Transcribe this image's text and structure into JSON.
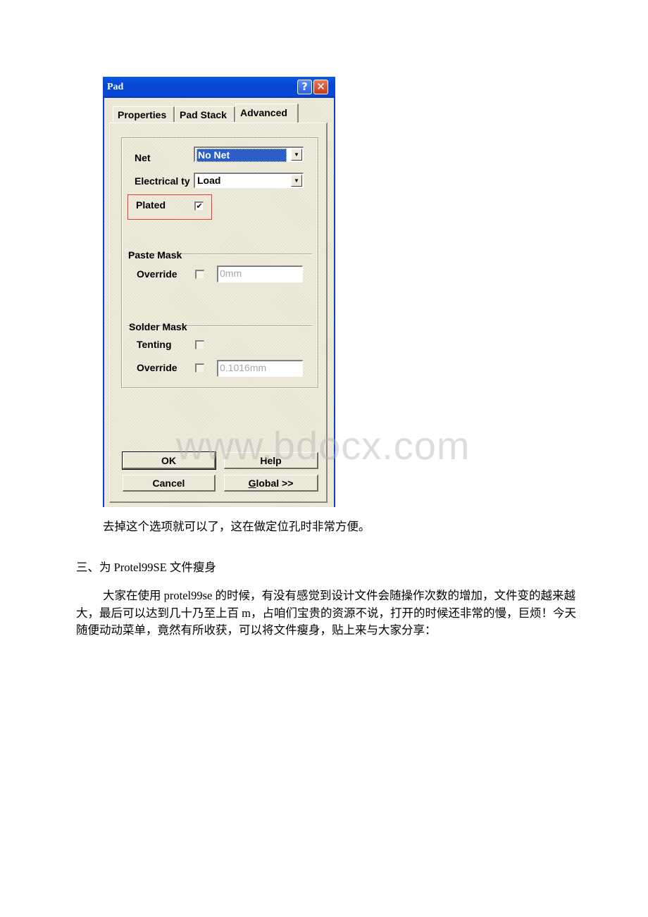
{
  "dialog": {
    "title": "Pad",
    "title_buttons": {
      "help": "?",
      "close": "✕"
    },
    "tabs": [
      {
        "label": "Properties",
        "active": false
      },
      {
        "label": "Pad Stack",
        "active": false
      },
      {
        "label": "Advanced",
        "active": true
      }
    ],
    "net": {
      "label": "Net",
      "value": "No Net"
    },
    "electrical_type": {
      "label": "Electrical ty",
      "value": "Load"
    },
    "plated": {
      "label": "Plated",
      "checked": true,
      "check_glyph": "✔"
    },
    "paste_mask": {
      "title": "Paste Mask",
      "override": {
        "label": "Override",
        "checked": false,
        "value": "0mm"
      }
    },
    "solder_mask": {
      "title": "Solder Mask",
      "tenting": {
        "label": "Tenting",
        "checked": false
      },
      "override": {
        "label": "Override",
        "checked": false,
        "value": "0.1016mm"
      }
    },
    "buttons": {
      "ok": "OK",
      "help": "Help",
      "cancel": "Cancel",
      "global_prefix": "G",
      "global_rest": "lobal >>"
    },
    "highlight_color": "#e53a32"
  },
  "watermark": "www.bdocx.com",
  "document": {
    "caption": "去掉这个选项就可以了，这在做定位孔时非常方便。",
    "section_heading": "三、为 Protel99SE 文件瘦身",
    "paragraph": "大家在使用 protel99se 的时候，有没有感觉到设计文件会随操作次数的增加，文件变的越来越大，最后可以达到几十乃至上百 m，占咱们宝贵的资源不说，打开的时候还非常的慢，巨烦！今天随便动动菜单，竟然有所收获，可以将文件瘦身，贴上来与大家分享："
  }
}
